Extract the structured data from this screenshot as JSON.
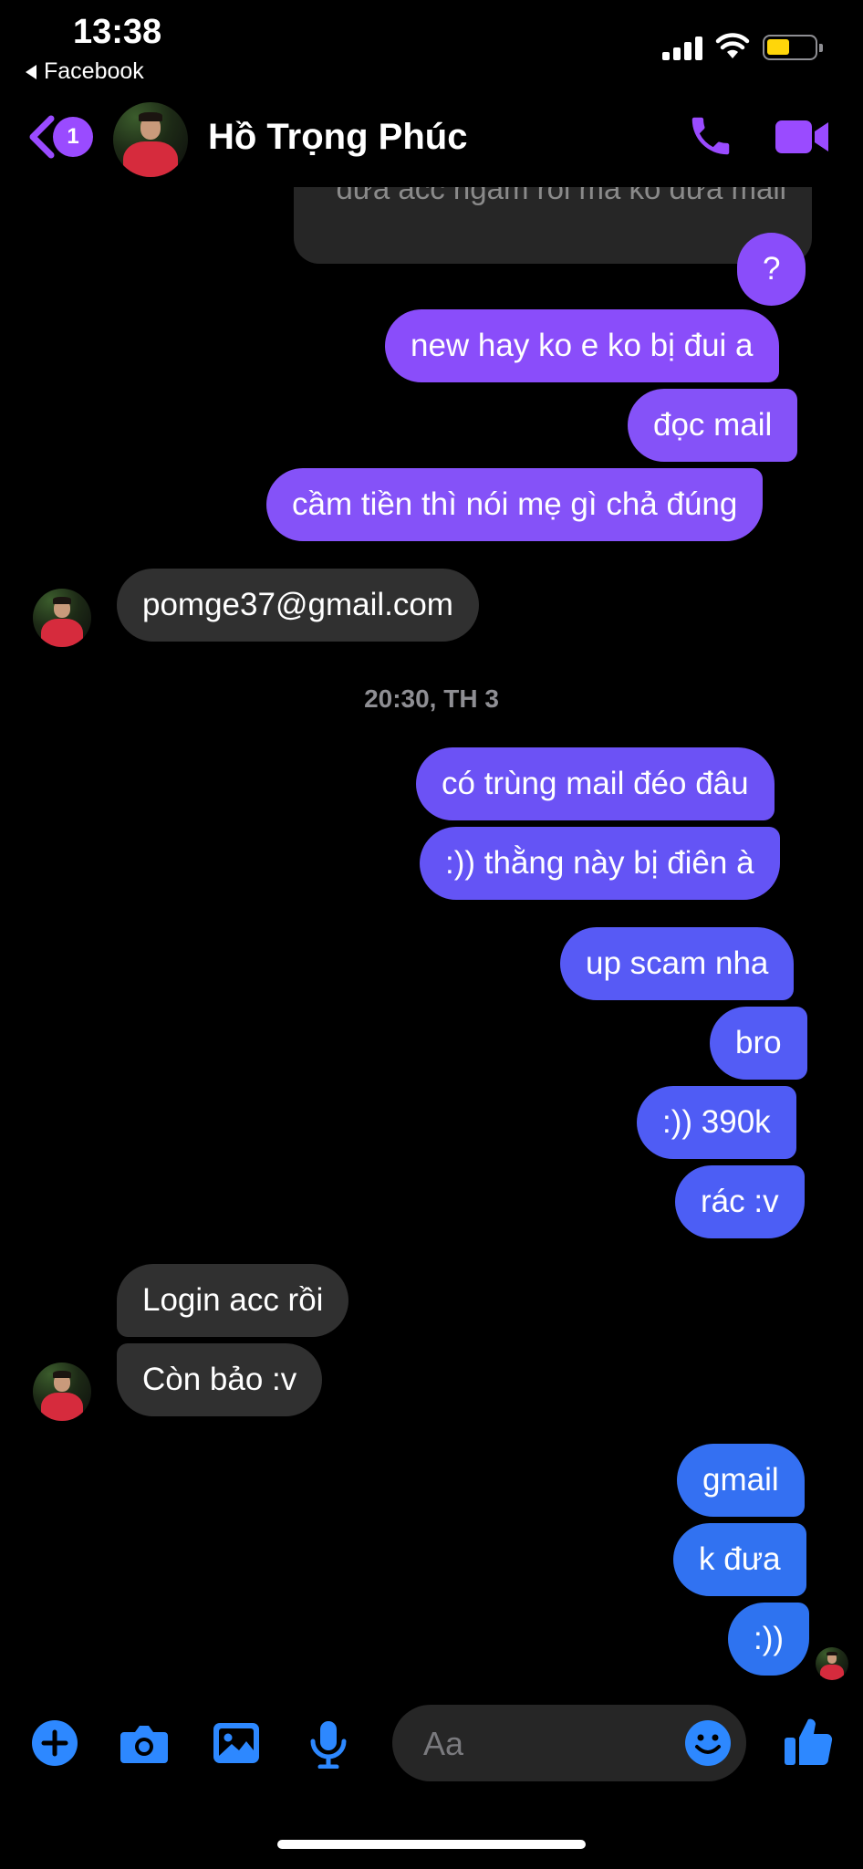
{
  "status_bar": {
    "time": "13:38",
    "back_app": "Facebook"
  },
  "header": {
    "unread_count": "1",
    "contact_name": "Hồ Trọng Phúc",
    "icons": [
      "back-chevron-icon",
      "phone-icon",
      "video-camera-icon"
    ]
  },
  "conversation": {
    "previous_partial": "đưa acc ngâm rồi mà ko đưa mail",
    "messages": [
      {
        "from": "me",
        "text": "?"
      },
      {
        "from": "me",
        "text": "new hay ko e ko bị đui a"
      },
      {
        "from": "me",
        "text": "đọc mail"
      },
      {
        "from": "me",
        "text": "cầm tiền thì nói mẹ gì chả đúng"
      },
      {
        "from": "them",
        "text": "pomge37@gmail.com"
      },
      {
        "from": "me",
        "text": "có trùng mail đéo đâu"
      },
      {
        "from": "me",
        "text": ":)) thằng này bị điên à"
      },
      {
        "from": "me",
        "text": "up scam nha"
      },
      {
        "from": "me",
        "text": "bro"
      },
      {
        "from": "me",
        "text": ":)) 390k"
      },
      {
        "from": "me",
        "text": "rác :v"
      },
      {
        "from": "them",
        "text": "Login acc rồi"
      },
      {
        "from": "them",
        "text": "Còn bảo :v"
      },
      {
        "from": "me",
        "text": "gmail"
      },
      {
        "from": "me",
        "text": "k đưa"
      },
      {
        "from": "me",
        "text": ":))"
      }
    ],
    "timestamp": "20:30, TH 3"
  },
  "composer": {
    "placeholder": "Aa",
    "icons": [
      "plus-icon",
      "camera-icon",
      "photo-icon",
      "microphone-icon",
      "emoji-icon",
      "thumbs-up-icon"
    ]
  },
  "colors": {
    "purple": "#8a4dfa",
    "violet": "#6c52f5",
    "blue_violet": "#4f5cf5",
    "blue": "#2e73f0",
    "accent_icon": "#9a4bff",
    "composer_icon": "#2d88ff",
    "incoming_bubble": "#303030"
  }
}
